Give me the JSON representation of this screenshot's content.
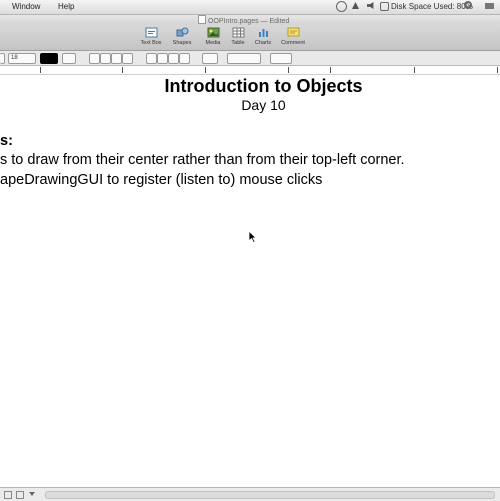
{
  "menubar": {
    "items": [
      "Window",
      "Help"
    ],
    "status_text": "Disk Space Used: 80%"
  },
  "window": {
    "title": "OOPIntro.pages — Edited"
  },
  "toolbar": {
    "tools": [
      {
        "label": "Text Box",
        "icon": "text-box-icon"
      },
      {
        "label": "Shapes",
        "icon": "shapes-icon"
      },
      {
        "label": "Media",
        "icon": "media-icon"
      },
      {
        "label": "Table",
        "icon": "table-icon"
      },
      {
        "label": "Charts",
        "icon": "chart-icon"
      },
      {
        "label": "Comment",
        "icon": "comment-icon"
      }
    ]
  },
  "formatbar": {
    "font_size": "18"
  },
  "document": {
    "title": "Introduction to Objects",
    "subtitle": "Day 10",
    "lines": [
      "s:",
      "s to draw from their center rather than from their top-left corner.",
      "apeDrawingGUI to register (listen to) mouse clicks"
    ]
  },
  "colors": {
    "text": "#000000",
    "chrome": "#d4d4d4",
    "background": "#ffffff"
  }
}
